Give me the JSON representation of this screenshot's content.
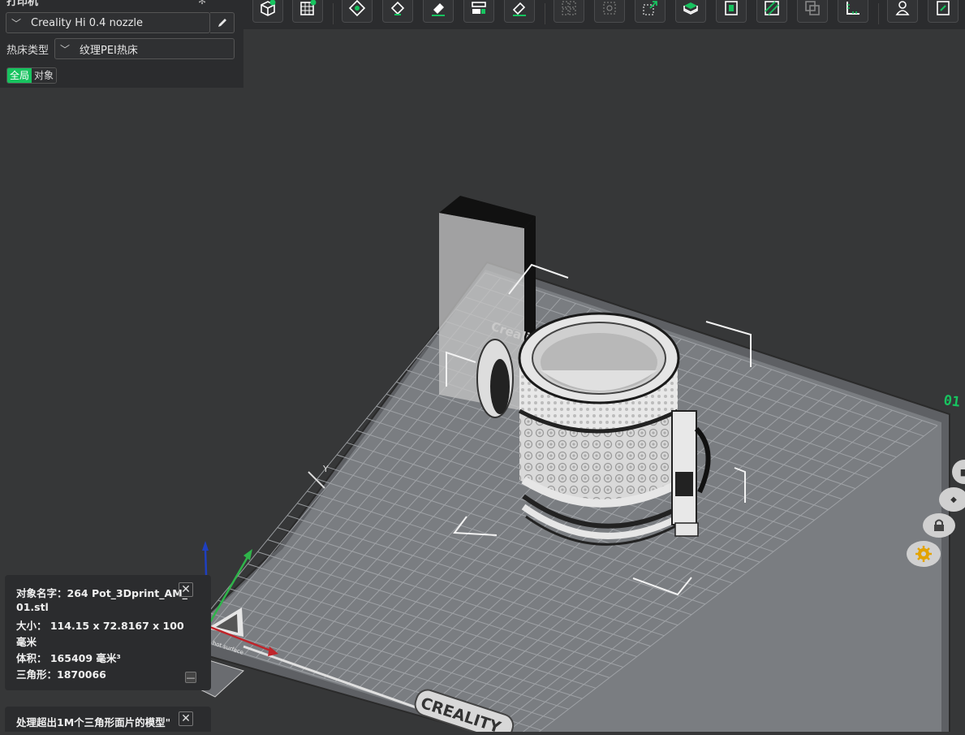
{
  "printer_panel": {
    "header_title": "打印机",
    "header_sub": "···· ·· ··",
    "printer_name": "Creality Hi 0.4 nozzle",
    "bed_type_label": "热床类型",
    "bed_type_value": "纹理PEI热床",
    "scope_tabs": [
      {
        "label": "全局",
        "active": true
      },
      {
        "label": "对象",
        "active": false
      }
    ]
  },
  "toolbar": {
    "buttons": [
      "add-object-icon",
      "add-plate-icon",
      "auto-orient-icon",
      "arrange-icon",
      "clear-plate-icon",
      "split-icon",
      "paint-icon",
      "seam-icon",
      "support-paint-icon",
      "scale-icon",
      "cut-icon",
      "hollow-icon",
      "variable-layer-icon",
      "boolean-icon",
      "measure-icon",
      "assembly-icon",
      "text-icon"
    ]
  },
  "scene": {
    "bed_brand": "CREALITY",
    "bed_brand_top": "Creality",
    "warning_text": "Warning hot surface",
    "axis_y_label": "Y",
    "plate_number": "01",
    "colors": {
      "background": "#363738",
      "bed": "#777a7e",
      "grid": "#9a9da1",
      "accent": "#17c35f"
    }
  },
  "object_info": {
    "name_line1": "对象名字：264 Pot_3Dprint_AM_",
    "name_line2": "01.stl",
    "size_line1": "大小：  114.15 x 72.8167 x 100",
    "size_line2": "毫米",
    "volume": "体积：  165409 毫米³",
    "triangles": "三角形：1870066"
  },
  "notice": {
    "text": "处理超出1M个三角形面片的模型\""
  },
  "side_buttons": [
    "camera-icon",
    "auto-icon",
    "lock-icon",
    "settings-gear-icon"
  ]
}
